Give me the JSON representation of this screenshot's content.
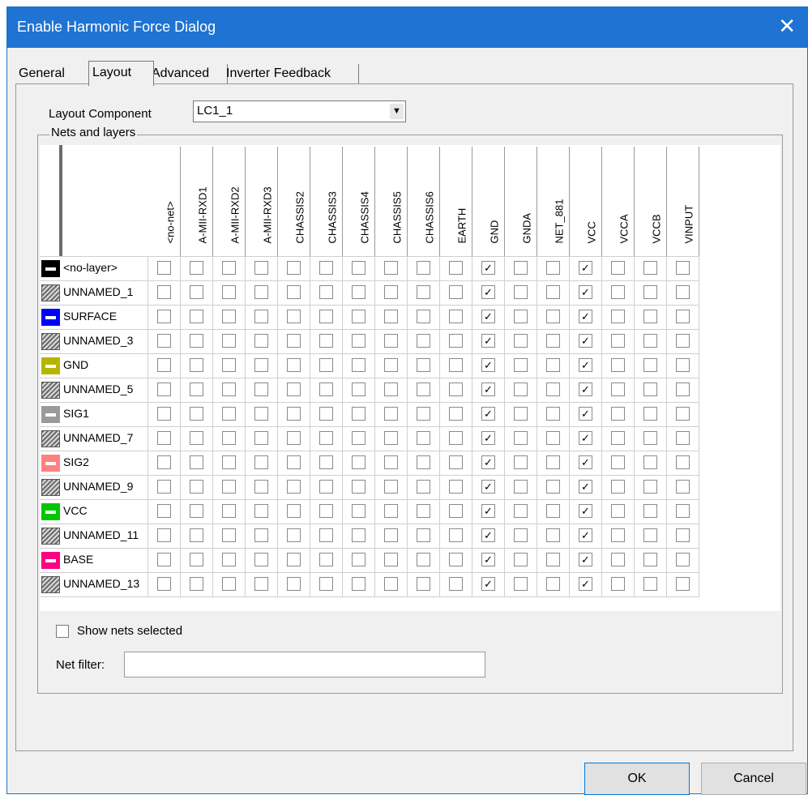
{
  "window": {
    "title": "Enable Harmonic Force Dialog",
    "close_glyph": "✕"
  },
  "tabs": [
    "General",
    "Layout",
    "Advanced",
    "Inverter Feedback"
  ],
  "active_tab": "Layout",
  "layout_component": {
    "label": "Layout Component",
    "value": "LC1_1",
    "arrow": "▼"
  },
  "group_label": "Nets and layers",
  "nets": [
    "<no-net>",
    "A-MII-RXD1",
    "A-MII-RXD2",
    "A-MII-RXD3",
    "CHASSIS2",
    "CHASSIS3",
    "CHASSIS4",
    "CHASSIS5",
    "CHASSIS6",
    "EARTH",
    "GND",
    "GNDA",
    "NET_881",
    "VCC",
    "VCCA",
    "VCCB",
    "VINPUT"
  ],
  "layers": [
    {
      "name": "<no-layer>",
      "color": "#000000",
      "pattern": "solid"
    },
    {
      "name": "UNNAMED_1",
      "color": "#555555",
      "pattern": "hatch"
    },
    {
      "name": "SURFACE",
      "color": "#0000ff",
      "pattern": "solid"
    },
    {
      "name": "UNNAMED_3",
      "color": "#555555",
      "pattern": "hatch"
    },
    {
      "name": "GND",
      "color": "#b5b500",
      "pattern": "solid"
    },
    {
      "name": "UNNAMED_5",
      "color": "#555555",
      "pattern": "hatch"
    },
    {
      "name": "SIG1",
      "color": "#9a9a9a",
      "pattern": "solid"
    },
    {
      "name": "UNNAMED_7",
      "color": "#555555",
      "pattern": "hatch"
    },
    {
      "name": "SIG2",
      "color": "#ff8080",
      "pattern": "solid"
    },
    {
      "name": "UNNAMED_9",
      "color": "#555555",
      "pattern": "hatch"
    },
    {
      "name": "VCC",
      "color": "#00c800",
      "pattern": "solid"
    },
    {
      "name": "UNNAMED_11",
      "color": "#555555",
      "pattern": "hatch"
    },
    {
      "name": "BASE",
      "color": "#ff0080",
      "pattern": "solid"
    },
    {
      "name": "UNNAMED_13",
      "color": "#555555",
      "pattern": "hatch"
    }
  ],
  "checked_nets": [
    "GND",
    "VCC"
  ],
  "show_nets_selected": {
    "label": "Show nets selected",
    "checked": false
  },
  "net_filter": {
    "label": "Net filter:",
    "value": ""
  },
  "buttons": {
    "ok": "OK",
    "cancel": "Cancel"
  }
}
